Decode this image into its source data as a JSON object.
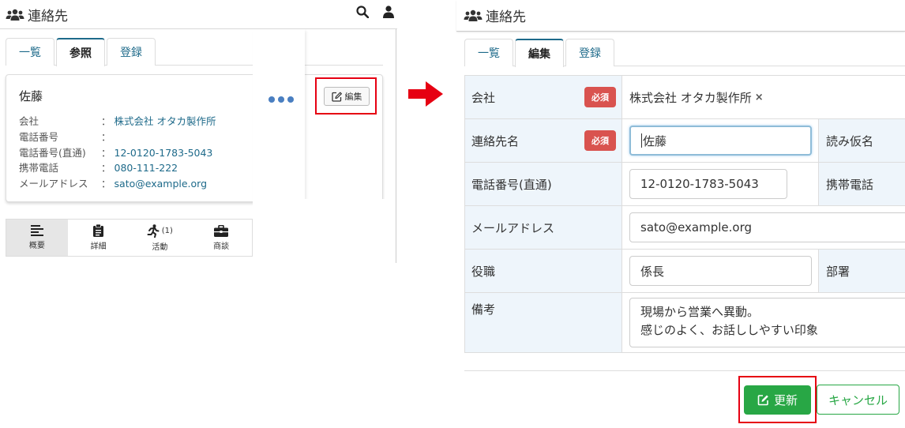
{
  "left": {
    "header": {
      "title": "連絡先"
    },
    "tabs": [
      {
        "label": "一覧"
      },
      {
        "label": "参照"
      },
      {
        "label": "登録"
      }
    ],
    "card": {
      "name": "佐藤",
      "separator": "：",
      "rows": [
        {
          "key": "会社",
          "value": "株式会社 オタカ製作所"
        },
        {
          "key": "電話番号",
          "value": ""
        },
        {
          "key": "電話番号(直通)",
          "value": "12-0120-1783-5043"
        },
        {
          "key": "携帯電話",
          "value": "080-111-222"
        },
        {
          "key": "メールアドレス",
          "value": "sato@example.org"
        }
      ],
      "edit_label": "編集"
    },
    "bottom_nav": [
      {
        "label": "概要",
        "icon": "list-icon"
      },
      {
        "label": "詳細",
        "icon": "clipboard-icon"
      },
      {
        "label": "活動",
        "icon": "running-icon",
        "count": "(1)"
      },
      {
        "label": "商談",
        "icon": "briefcase-icon"
      }
    ]
  },
  "right": {
    "header": {
      "title": "連絡先"
    },
    "tabs": [
      {
        "label": "一覧"
      },
      {
        "label": "編集"
      },
      {
        "label": "登録"
      }
    ],
    "required_label": "必須",
    "form": {
      "company": {
        "label": "会社",
        "value": "株式会社 オタカ製作所",
        "remove": "×"
      },
      "contact_name": {
        "label": "連絡先名",
        "value": "佐藤",
        "sub_label": "読み仮名"
      },
      "direct_phone": {
        "label": "電話番号(直通)",
        "value": "12-0120-1783-5043",
        "sub_label": "携帯電話"
      },
      "email": {
        "label": "メールアドレス",
        "value": "sato@example.org"
      },
      "position": {
        "label": "役職",
        "value": "係長",
        "sub_label": "部署"
      },
      "notes": {
        "label": "備考",
        "line1": "現場から営業へ異動。",
        "line2": "感じのよく、お話ししやすい印象"
      }
    },
    "update_label": "更新",
    "cancel_label": "キャンセル"
  },
  "colors": {
    "accent": "#1e6a8a",
    "required": "#d9534f",
    "success": "#28a745",
    "highlight": "#e60012",
    "label_bg": "#eef5fb"
  }
}
